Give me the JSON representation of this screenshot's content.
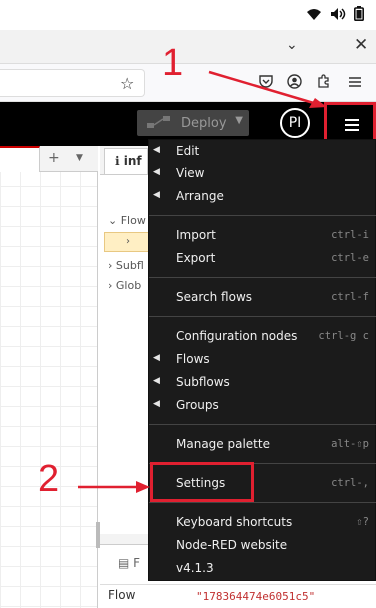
{
  "browser": {
    "star_icon": "star-icon",
    "pocket_icon": "pocket-icon",
    "account_icon": "account-icon",
    "extensions_icon": "extensions-icon",
    "menu_icon": "menu-icon"
  },
  "header": {
    "deploy_label": "Deploy",
    "avatar_initials": "PI"
  },
  "sidebar": {
    "tab_label": "inf",
    "tree": [
      "Flow",
      "Subfl",
      "Glob"
    ],
    "info_title": "F",
    "info_key": "Flow",
    "info_value": "\"178364474e6051c5\""
  },
  "menu": {
    "items": [
      {
        "label": "Edit",
        "shortcut": "",
        "submenu": true
      },
      {
        "label": "View",
        "shortcut": "",
        "submenu": true
      },
      {
        "label": "Arrange",
        "shortcut": "",
        "submenu": true
      },
      {
        "label": "Import",
        "shortcut": "ctrl-i",
        "submenu": false
      },
      {
        "label": "Export",
        "shortcut": "ctrl-e",
        "submenu": false
      },
      {
        "label": "Search flows",
        "shortcut": "ctrl-f",
        "submenu": false
      },
      {
        "label": "Configuration nodes",
        "shortcut": "ctrl-g c",
        "submenu": false
      },
      {
        "label": "Flows",
        "shortcut": "",
        "submenu": true
      },
      {
        "label": "Subflows",
        "shortcut": "",
        "submenu": true
      },
      {
        "label": "Groups",
        "shortcut": "",
        "submenu": true
      },
      {
        "label": "Manage palette",
        "shortcut": "alt-⇧p",
        "submenu": false
      },
      {
        "label": "Settings",
        "shortcut": "ctrl-,",
        "submenu": false
      },
      {
        "label": "Keyboard shortcuts",
        "shortcut": "⇧?",
        "submenu": false
      },
      {
        "label": "Node-RED website",
        "shortcut": "",
        "submenu": false
      },
      {
        "label": "v4.1.3",
        "shortcut": "",
        "submenu": false
      }
    ]
  },
  "annotations": {
    "step1": "1",
    "step2": "2",
    "color": "#e02030"
  }
}
